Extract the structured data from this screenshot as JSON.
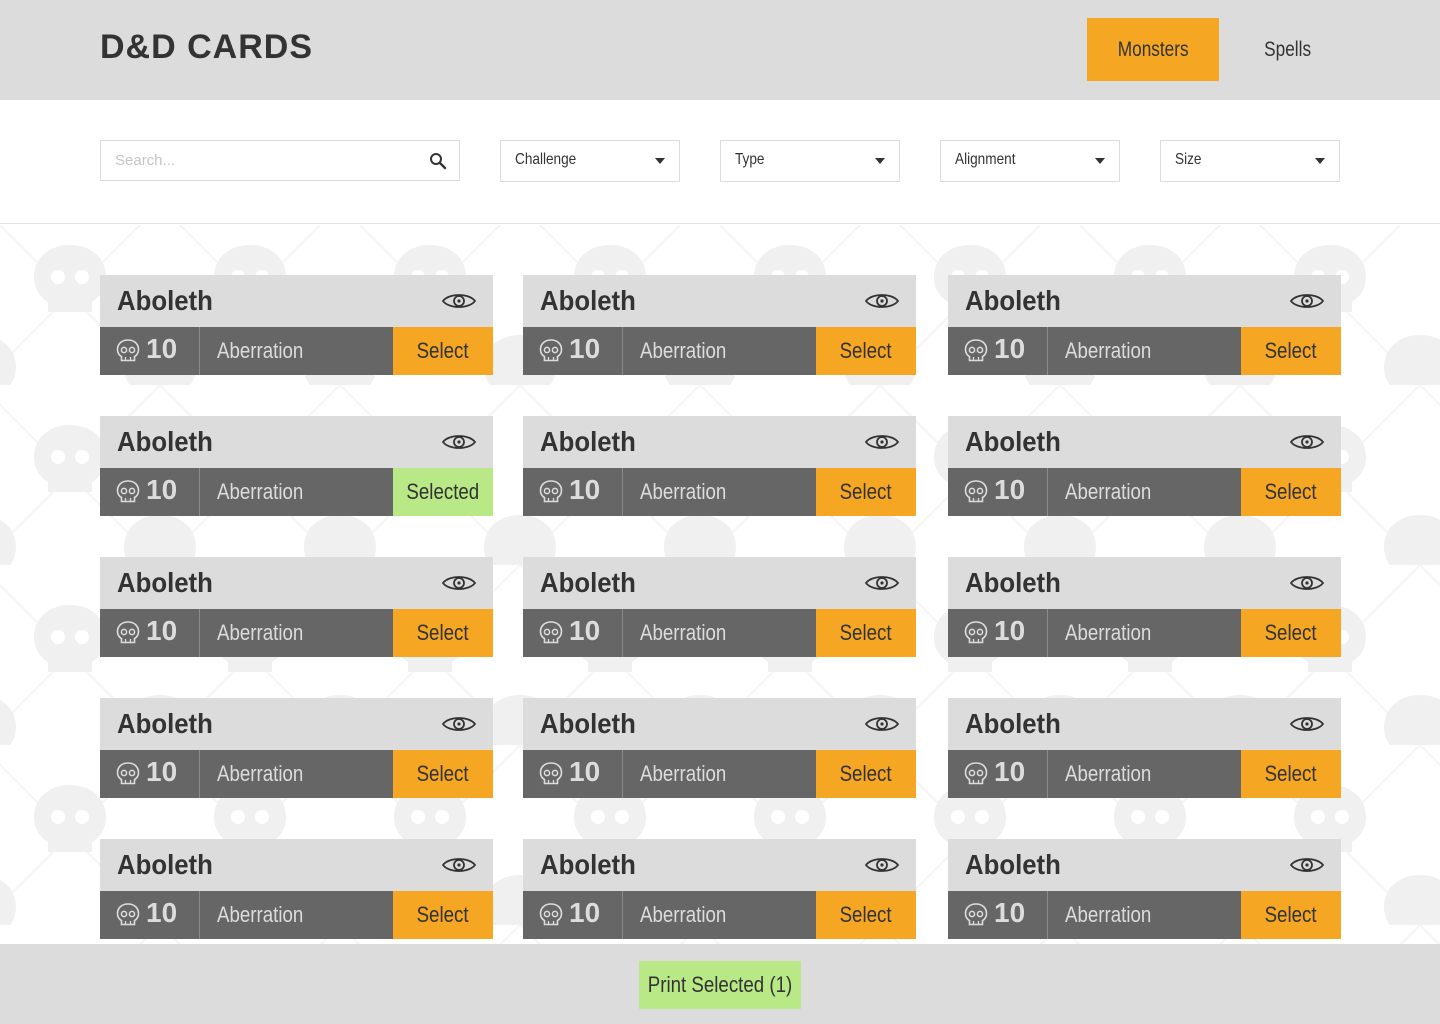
{
  "app": {
    "title": "D&D CARDS"
  },
  "nav": {
    "tabs": [
      {
        "label": "Monsters",
        "active": true
      },
      {
        "label": "Spells",
        "active": false
      }
    ]
  },
  "filters": {
    "search_placeholder": "Search...",
    "challenge_label": "Challenge",
    "type_label": "Type",
    "alignment_label": "Alignment",
    "size_label": "Size"
  },
  "cards": [
    {
      "name": "Aboleth",
      "challenge": "10",
      "type": "Aberration",
      "action": "Select",
      "selected": false
    },
    {
      "name": "Aboleth",
      "challenge": "10",
      "type": "Aberration",
      "action": "Select",
      "selected": false
    },
    {
      "name": "Aboleth",
      "challenge": "10",
      "type": "Aberration",
      "action": "Select",
      "selected": false
    },
    {
      "name": "Aboleth",
      "challenge": "10",
      "type": "Aberration",
      "action": "Selected",
      "selected": true
    },
    {
      "name": "Aboleth",
      "challenge": "10",
      "type": "Aberration",
      "action": "Select",
      "selected": false
    },
    {
      "name": "Aboleth",
      "challenge": "10",
      "type": "Aberration",
      "action": "Select",
      "selected": false
    },
    {
      "name": "Aboleth",
      "challenge": "10",
      "type": "Aberration",
      "action": "Select",
      "selected": false
    },
    {
      "name": "Aboleth",
      "challenge": "10",
      "type": "Aberration",
      "action": "Select",
      "selected": false
    },
    {
      "name": "Aboleth",
      "challenge": "10",
      "type": "Aberration",
      "action": "Select",
      "selected": false
    },
    {
      "name": "Aboleth",
      "challenge": "10",
      "type": "Aberration",
      "action": "Select",
      "selected": false
    },
    {
      "name": "Aboleth",
      "challenge": "10",
      "type": "Aberration",
      "action": "Select",
      "selected": false
    },
    {
      "name": "Aboleth",
      "challenge": "10",
      "type": "Aberration",
      "action": "Select",
      "selected": false
    },
    {
      "name": "Aboleth",
      "challenge": "10",
      "type": "Aberration",
      "action": "Select",
      "selected": false
    },
    {
      "name": "Aboleth",
      "challenge": "10",
      "type": "Aberration",
      "action": "Select",
      "selected": false
    },
    {
      "name": "Aboleth",
      "challenge": "10",
      "type": "Aberration",
      "action": "Select",
      "selected": false
    }
  ],
  "icons": {
    "card_view": "eye-icon",
    "challenge": "skull-icon",
    "search": "search-icon",
    "dropdown": "chevron-down-icon"
  },
  "footer": {
    "print_label": "Print Selected (1)"
  },
  "colors": {
    "accent": "#f5a623",
    "selected": "#b8e986",
    "header_bg": "#dcdcdc",
    "card_bar": "#666666",
    "text_dark": "#333333"
  }
}
